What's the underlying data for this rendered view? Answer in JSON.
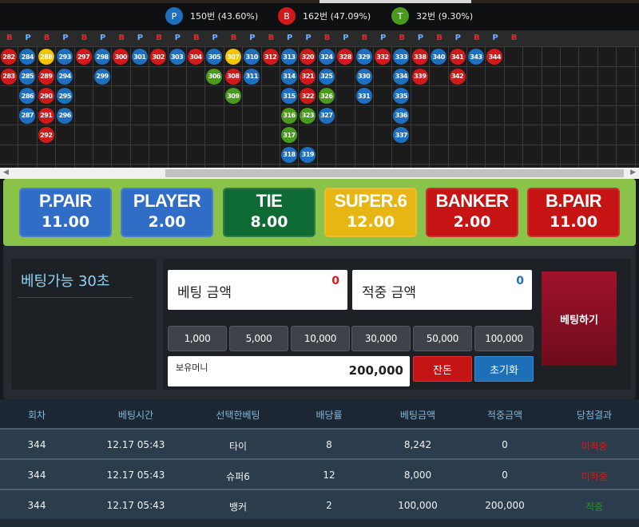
{
  "stats": [
    {
      "letter": "P",
      "text": "150번 (43.60%)",
      "color": "#1e6fbf"
    },
    {
      "letter": "B",
      "text": "162번 (47.09%)",
      "color": "#d01a1a"
    },
    {
      "letter": "T",
      "text": "32번 (9.30%)",
      "color": "#4a9a1e"
    }
  ],
  "road": {
    "labels": [
      {
        "t": "B",
        "c": "#e23"
      },
      {
        "t": "P",
        "c": "#6ab0ff"
      },
      {
        "t": "B",
        "c": "#e23"
      },
      {
        "t": "P",
        "c": "#6ab0ff"
      },
      {
        "t": "B",
        "c": "#e23"
      },
      {
        "t": "P",
        "c": "#6ab0ff"
      },
      {
        "t": "B",
        "c": "#e23"
      },
      {
        "t": "P",
        "c": "#6ab0ff"
      },
      {
        "t": "B",
        "c": "#e23"
      },
      {
        "t": "P",
        "c": "#6ab0ff"
      },
      {
        "t": "B",
        "c": "#e23"
      },
      {
        "t": "P",
        "c": "#6ab0ff"
      },
      {
        "t": "B",
        "c": "#e23"
      },
      {
        "t": "P",
        "c": "#6ab0ff"
      },
      {
        "t": "B",
        "c": "#e23"
      },
      {
        "t": "P",
        "c": "#6ab0ff"
      },
      {
        "t": "P",
        "c": "#6ab0ff"
      },
      {
        "t": "B",
        "c": "#e23"
      },
      {
        "t": "P",
        "c": "#6ab0ff"
      },
      {
        "t": "B",
        "c": "#e23"
      },
      {
        "t": "P",
        "c": "#6ab0ff"
      },
      {
        "t": "B",
        "c": "#e23"
      },
      {
        "t": "P",
        "c": "#6ab0ff"
      },
      {
        "t": "B",
        "c": "#e23"
      },
      {
        "t": "P",
        "c": "#6ab0ff"
      },
      {
        "t": "B",
        "c": "#e23"
      },
      {
        "t": "P",
        "c": "#6ab0ff"
      },
      {
        "t": "B",
        "c": "#e23"
      }
    ],
    "beads": [
      {
        "n": "282",
        "k": "B",
        "col": 0,
        "row": 0
      },
      {
        "n": "283",
        "k": "B",
        "col": 0,
        "row": 1
      },
      {
        "n": "284",
        "k": "P",
        "col": 1,
        "row": 0
      },
      {
        "n": "285",
        "k": "P",
        "col": 1,
        "row": 1
      },
      {
        "n": "286",
        "k": "P",
        "col": 1,
        "row": 2
      },
      {
        "n": "287",
        "k": "P",
        "col": 1,
        "row": 3
      },
      {
        "n": "288",
        "k": "Y",
        "col": 2,
        "row": 0
      },
      {
        "n": "289",
        "k": "B",
        "col": 2,
        "row": 1
      },
      {
        "n": "290",
        "k": "B",
        "col": 2,
        "row": 2
      },
      {
        "n": "291",
        "k": "B",
        "col": 2,
        "row": 3
      },
      {
        "n": "292",
        "k": "B",
        "col": 2,
        "row": 4
      },
      {
        "n": "293",
        "k": "P",
        "col": 3,
        "row": 0
      },
      {
        "n": "294",
        "k": "P",
        "col": 3,
        "row": 1
      },
      {
        "n": "295",
        "k": "P",
        "col": 3,
        "row": 2
      },
      {
        "n": "296",
        "k": "P",
        "col": 3,
        "row": 3
      },
      {
        "n": "297",
        "k": "B",
        "col": 4,
        "row": 0
      },
      {
        "n": "298",
        "k": "P",
        "col": 5,
        "row": 0
      },
      {
        "n": "299",
        "k": "P",
        "col": 5,
        "row": 1
      },
      {
        "n": "300",
        "k": "B",
        "col": 6,
        "row": 0
      },
      {
        "n": "301",
        "k": "P",
        "col": 7,
        "row": 0
      },
      {
        "n": "302",
        "k": "B",
        "col": 8,
        "row": 0
      },
      {
        "n": "303",
        "k": "P",
        "col": 9,
        "row": 0
      },
      {
        "n": "304",
        "k": "B",
        "col": 10,
        "row": 0
      },
      {
        "n": "305",
        "k": "P",
        "col": 11,
        "row": 0
      },
      {
        "n": "306",
        "k": "T",
        "col": 11,
        "row": 1
      },
      {
        "n": "307",
        "k": "Y",
        "col": 12,
        "row": 0
      },
      {
        "n": "308",
        "k": "B",
        "col": 12,
        "row": 1
      },
      {
        "n": "309",
        "k": "T",
        "col": 12,
        "row": 2
      },
      {
        "n": "310",
        "k": "P",
        "col": 13,
        "row": 0
      },
      {
        "n": "311",
        "k": "P",
        "col": 13,
        "row": 1
      },
      {
        "n": "312",
        "k": "B",
        "col": 14,
        "row": 0
      },
      {
        "n": "313",
        "k": "P",
        "col": 15,
        "row": 0
      },
      {
        "n": "314",
        "k": "P",
        "col": 15,
        "row": 1
      },
      {
        "n": "315",
        "k": "P",
        "col": 15,
        "row": 2
      },
      {
        "n": "316",
        "k": "T",
        "col": 15,
        "row": 3
      },
      {
        "n": "317",
        "k": "T",
        "col": 15,
        "row": 4
      },
      {
        "n": "318",
        "k": "P",
        "col": 15,
        "row": 5
      },
      {
        "n": "319",
        "k": "P",
        "col": 16,
        "row": 5
      },
      {
        "n": "320",
        "k": "B",
        "col": 16,
        "row": 0
      },
      {
        "n": "321",
        "k": "B",
        "col": 16,
        "row": 1
      },
      {
        "n": "322",
        "k": "B",
        "col": 16,
        "row": 2
      },
      {
        "n": "323",
        "k": "T",
        "col": 16,
        "row": 3
      },
      {
        "n": "324",
        "k": "P",
        "col": 17,
        "row": 0
      },
      {
        "n": "325",
        "k": "P",
        "col": 17,
        "row": 1
      },
      {
        "n": "326",
        "k": "T",
        "col": 17,
        "row": 2
      },
      {
        "n": "327",
        "k": "P",
        "col": 17,
        "row": 3
      },
      {
        "n": "328",
        "k": "B",
        "col": 18,
        "row": 0
      },
      {
        "n": "329",
        "k": "P",
        "col": 19,
        "row": 0
      },
      {
        "n": "330",
        "k": "P",
        "col": 19,
        "row": 1
      },
      {
        "n": "331",
        "k": "P",
        "col": 19,
        "row": 2
      },
      {
        "n": "332",
        "k": "B",
        "col": 20,
        "row": 0
      },
      {
        "n": "333",
        "k": "P",
        "col": 21,
        "row": 0
      },
      {
        "n": "334",
        "k": "P",
        "col": 21,
        "row": 1
      },
      {
        "n": "335",
        "k": "P",
        "col": 21,
        "row": 2
      },
      {
        "n": "336",
        "k": "P",
        "col": 21,
        "row": 3
      },
      {
        "n": "337",
        "k": "P",
        "col": 21,
        "row": 4
      },
      {
        "n": "338",
        "k": "B",
        "col": 22,
        "row": 0
      },
      {
        "n": "339",
        "k": "B",
        "col": 22,
        "row": 1
      },
      {
        "n": "340",
        "k": "P",
        "col": 23,
        "row": 0
      },
      {
        "n": "341",
        "k": "B",
        "col": 24,
        "row": 0
      },
      {
        "n": "342",
        "k": "B",
        "col": 24,
        "row": 1
      },
      {
        "n": "343",
        "k": "P",
        "col": 25,
        "row": 0
      },
      {
        "n": "344",
        "k": "B",
        "col": 26,
        "row": 0
      }
    ],
    "colors": {
      "P": "#1e6fbf",
      "B": "#d01a1a",
      "T": "#4a9a1e",
      "Y": "#f2c400"
    }
  },
  "options": [
    {
      "name": "P.PAIR",
      "odds": "11.00",
      "color": "#2f6dc7"
    },
    {
      "name": "PLAYER",
      "odds": "2.00",
      "color": "#2f6dc7"
    },
    {
      "name": "TIE",
      "odds": "8.00",
      "color": "#0f6b34"
    },
    {
      "name": "SUPER.6",
      "odds": "12.00",
      "color": "#e8b613"
    },
    {
      "name": "BANKER",
      "odds": "2.00",
      "color": "#c61313"
    },
    {
      "name": "B.PAIR",
      "odds": "11.00",
      "color": "#c61313"
    }
  ],
  "timer": "베팅가능 30초",
  "bet": {
    "amount_label": "베팅 금액",
    "amount_value": "0",
    "payout_label": "적중 금액",
    "payout_value": "0",
    "chips": [
      "1,000",
      "5,000",
      "10,000",
      "30,000",
      "50,000",
      "100,000"
    ],
    "money_label": "보유머니",
    "money_value": "200,000",
    "change_label": "잔돈",
    "reset_label": "초기화",
    "submit_label": "베팅하기"
  },
  "history": {
    "headers": [
      "회차",
      "베팅시간",
      "선택한베팅",
      "배당률",
      "베팅금액",
      "적중금액",
      "당첨결과"
    ],
    "rows": [
      {
        "cells": [
          "344",
          "12.17 05:43",
          "타이",
          "8",
          "8,242",
          "0",
          "미적중"
        ],
        "win": false
      },
      {
        "cells": [
          "344",
          "12.17 05:43",
          "슈퍼6",
          "12",
          "8,000",
          "0",
          "미적중"
        ],
        "win": false
      },
      {
        "cells": [
          "344",
          "12.17 05:43",
          "뱅커",
          "2",
          "100,000",
          "200,000",
          "적중"
        ],
        "win": true
      }
    ]
  }
}
